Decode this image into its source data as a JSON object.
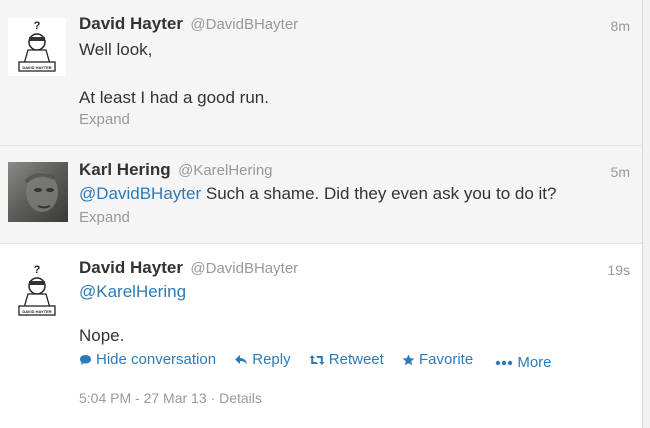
{
  "tweets": [
    {
      "fullname": "David Hayter",
      "username": "@DavidBHayter",
      "time": "8m",
      "line1": "Well look,",
      "line2": "At least I had a good run.",
      "expand": "Expand"
    },
    {
      "fullname": "Karl Hering",
      "username": "@KarelHering",
      "time": "5m",
      "mention": "@DavidBHayter",
      "text": " Such a shame. Did they even ask you to do it?",
      "expand": "Expand"
    },
    {
      "fullname": "David Hayter",
      "username": "@DavidBHayter",
      "time": "19s",
      "mention": "@KarelHering",
      "line2": "Nope.",
      "actions": {
        "hide": "Hide conversation",
        "reply": "Reply",
        "retweet": "Retweet",
        "favorite": "Favorite",
        "more": "More"
      },
      "timestamp": "5:04 PM - 27 Mar 13",
      "separator": "·",
      "details": "Details"
    }
  ],
  "avatar_text": {
    "question": "?",
    "sign": "DAVID HAYTER"
  },
  "colors": {
    "link": "#2b7bb9",
    "muted": "#999999",
    "text": "#333333",
    "selected_bg": "#f5f5f5"
  }
}
